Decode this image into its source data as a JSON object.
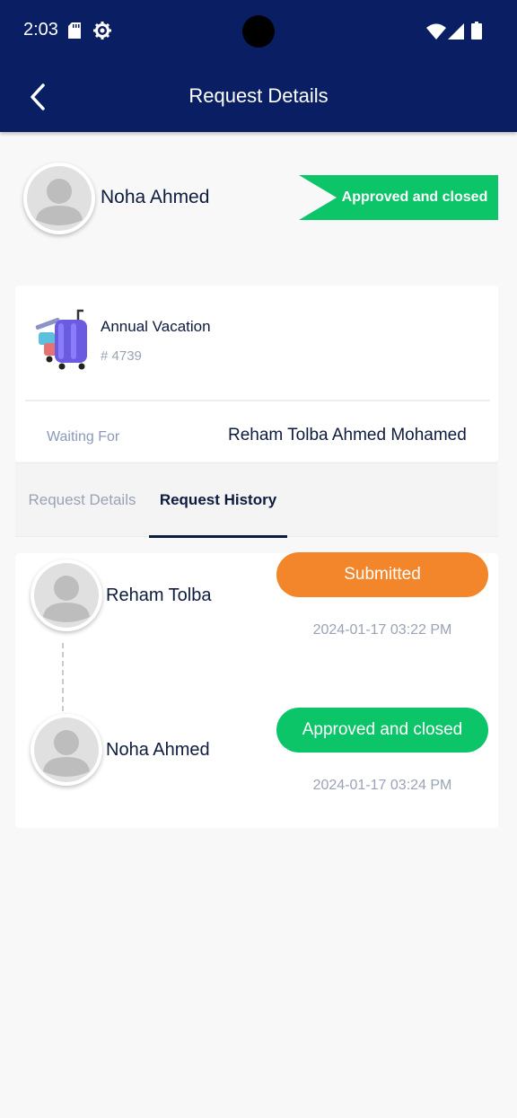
{
  "status_bar": {
    "time": "2:03"
  },
  "app_bar": {
    "title": "Request Details"
  },
  "header": {
    "employee_name": "Noha Ahmed",
    "status": "Approved and closed",
    "status_color": "#0bc568"
  },
  "request": {
    "type": "Annual Vacation",
    "number": "# 4739",
    "waiting_label": "Waiting For",
    "waiting_value": "Reham Tolba Ahmed Mohamed"
  },
  "tabs": [
    {
      "label": "Request Details",
      "active": false
    },
    {
      "label": "Request History",
      "active": true
    }
  ],
  "history": [
    {
      "name": "Reham Tolba",
      "status": "Submitted",
      "color": "#f3862a",
      "date": "2024-01-17 03:22 PM"
    },
    {
      "name": "Noha Ahmed",
      "status": "Approved and closed",
      "color": "#0bc568",
      "date": "2024-01-17 03:24 PM"
    }
  ],
  "colors": {
    "primary": "#0a1f63",
    "text": "#0d1b3e",
    "muted": "#9aa3b5",
    "background": "#f8f8f8"
  }
}
